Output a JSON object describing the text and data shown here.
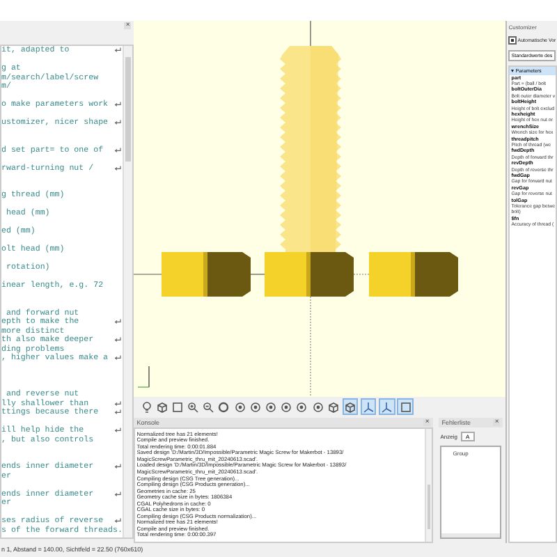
{
  "editor": {
    "title_close": "×",
    "lines": [
      {
        "kind": "text",
        "text": "it, adapted to",
        "wrap": true
      },
      {
        "kind": "blank"
      },
      {
        "kind": "text",
        "text": "g at",
        "wrap": false
      },
      {
        "kind": "text",
        "text": "m/search/label/screw",
        "wrap": false
      },
      {
        "kind": "text",
        "text": "m/",
        "wrap": false
      },
      {
        "kind": "blank"
      },
      {
        "kind": "text",
        "text": "o make parameters work",
        "wrap": true
      },
      {
        "kind": "blank"
      },
      {
        "kind": "text",
        "text": "ustomizer, nicer shape",
        "wrap": true
      },
      {
        "kind": "blank"
      },
      {
        "kind": "blank"
      },
      {
        "kind": "text",
        "text": "d set part= to one of",
        "wrap": true
      },
      {
        "kind": "blank"
      },
      {
        "kind": "text",
        "text": "rward-turning nut /",
        "wrap": true
      },
      {
        "kind": "blank"
      },
      {
        "kind": "blank"
      },
      {
        "kind": "text",
        "text": "g thread (mm)",
        "wrap": false
      },
      {
        "kind": "blank"
      },
      {
        "kind": "text",
        "text": " head (mm)",
        "wrap": false
      },
      {
        "kind": "blank"
      },
      {
        "kind": "text",
        "text": "ed (mm)",
        "wrap": false
      },
      {
        "kind": "blank"
      },
      {
        "kind": "text",
        "text": "olt head (mm)",
        "wrap": false
      },
      {
        "kind": "blank"
      },
      {
        "kind": "text",
        "text": " rotation)",
        "wrap": false
      },
      {
        "kind": "blank"
      },
      {
        "kind": "text",
        "text": "inear length, e.g. 72",
        "wrap": false
      },
      {
        "kind": "blank"
      },
      {
        "kind": "blank"
      },
      {
        "kind": "text",
        "text": " and forward nut",
        "wrap": false
      },
      {
        "kind": "text",
        "text": "epth to make the",
        "wrap": true
      },
      {
        "kind": "text",
        "text": "more distinct",
        "wrap": false
      },
      {
        "kind": "text",
        "text": "th also make deeper",
        "wrap": true
      },
      {
        "kind": "text",
        "text": "ding problems",
        "wrap": false
      },
      {
        "kind": "text",
        "text": ", higher values make a",
        "wrap": true
      },
      {
        "kind": "blank"
      },
      {
        "kind": "blank"
      },
      {
        "kind": "blank"
      },
      {
        "kind": "text",
        "text": " and reverse nut",
        "wrap": false
      },
      {
        "kind": "text",
        "text": "lly shallower than",
        "wrap": true
      },
      {
        "kind": "text",
        "text": "ttings because there",
        "wrap": true
      },
      {
        "kind": "blank"
      },
      {
        "kind": "text",
        "text": "ill help hide the",
        "wrap": true
      },
      {
        "kind": "text",
        "text": ", but also controls",
        "wrap": false
      },
      {
        "kind": "blank"
      },
      {
        "kind": "blank"
      },
      {
        "kind": "text",
        "text": "ends inner diameter",
        "wrap": true
      },
      {
        "kind": "text",
        "text": "er",
        "wrap": false
      },
      {
        "kind": "blank"
      },
      {
        "kind": "text",
        "text": "ends inner diameter",
        "wrap": true
      },
      {
        "kind": "text",
        "text": "er",
        "wrap": false
      },
      {
        "kind": "blank"
      },
      {
        "kind": "text",
        "text": "ses radius of reverse",
        "wrap": true
      },
      {
        "kind": "text",
        "text": "s of the forward threads.",
        "wrap": false
      }
    ]
  },
  "toolbar": [
    {
      "kind": "bulb",
      "on": false
    },
    {
      "kind": "cube",
      "on": false
    },
    {
      "kind": "frame",
      "on": false
    },
    {
      "kind": "zoom-in",
      "on": false
    },
    {
      "kind": "zoom-out",
      "on": false
    },
    {
      "kind": "rotate",
      "on": false
    },
    {
      "kind": "sphere",
      "on": false
    },
    {
      "kind": "sphere",
      "on": false
    },
    {
      "kind": "sphere",
      "on": false
    },
    {
      "kind": "sphere",
      "on": false
    },
    {
      "kind": "sphere",
      "on": false
    },
    {
      "kind": "sphere",
      "on": false
    },
    {
      "kind": "cube",
      "on": false
    },
    {
      "kind": "cube",
      "on": true
    },
    {
      "kind": "axes",
      "on": true
    },
    {
      "kind": "axes",
      "on": true
    },
    {
      "kind": "frame",
      "on": true
    }
  ],
  "console": {
    "title": "Konsole",
    "close": "×",
    "lines": [
      "Normalized tree has 21 elements!",
      "Compile and preview finished.",
      "Total rendering time: 0:00:01.884",
      "Saved design 'D:/Martin/3D/Impossible/Parametric Magic Screw for Makerbot - 13893/",
      "MagicScrewParametric_thru_mit_20240613.scad'.",
      "Loaded design 'D:/Martin/3D/Impossible/Parametric Magic Screw for Makerbot - 13893/",
      "MagicScrewParametric_thru_mit_20240613.scad'.",
      "Compiling design (CSG Tree generation)...",
      "Compiling design (CSG Products generation)...",
      "Geometries in cache: 25",
      "Geometry cache size in bytes: 1806384",
      "CGAL Polyhedrons in cache: 0",
      "CGAL cache size in bytes: 0",
      "Compiling design (CSG Products normalization)...",
      "Normalized tree has 21 elements!",
      "Compile and preview finished.",
      "Total rendering time: 0:00:00.397"
    ]
  },
  "error_list": {
    "title": "Fehlerliste",
    "close": "×",
    "filter_label": "Anzeig",
    "filter_value": "A",
    "items": [
      "Group"
    ]
  },
  "customizer": {
    "title": "Customizer",
    "auto_preview": {
      "label": "Automatische Vor",
      "checked": true
    },
    "preset": "Standardwerte des",
    "section": {
      "title": "Parameters",
      "expanded": true
    },
    "params": [
      {
        "name": "part",
        "lines": [
          "Part = (ball / bolt"
        ]
      },
      {
        "name": "boltOuterDia",
        "lines": [
          "Bolt outer diameter v"
        ]
      },
      {
        "name": "boltHeight",
        "lines": [
          "Height of bolt exclud"
        ]
      },
      {
        "name": "hexheight",
        "lines": [
          "Height of hex nut or"
        ]
      },
      {
        "name": "wrenchSize",
        "lines": [
          "Wrench size for hex"
        ]
      },
      {
        "name": "threadpitch",
        "lines": [
          "Pitch of thread (we"
        ]
      },
      {
        "name": "fwdDepth",
        "lines": [
          "Depth of forward thr"
        ]
      },
      {
        "name": "revDepth",
        "lines": [
          "Depth of reverse thr"
        ]
      },
      {
        "name": "fwdGap",
        "lines": [
          "Gap for forward nut"
        ]
      },
      {
        "name": "revGap",
        "lines": [
          "Gap for reverse nut"
        ]
      },
      {
        "name": "tolGap",
        "lines": [
          "Tolerance gap betwe",
          "bolt)"
        ]
      },
      {
        "name": "$fn",
        "lines": [
          "Accuracy of thread ("
        ]
      }
    ]
  },
  "status_bar": "n 1, Abstand = 140.00, Sichtfeld = 22.50 (760x610)"
}
